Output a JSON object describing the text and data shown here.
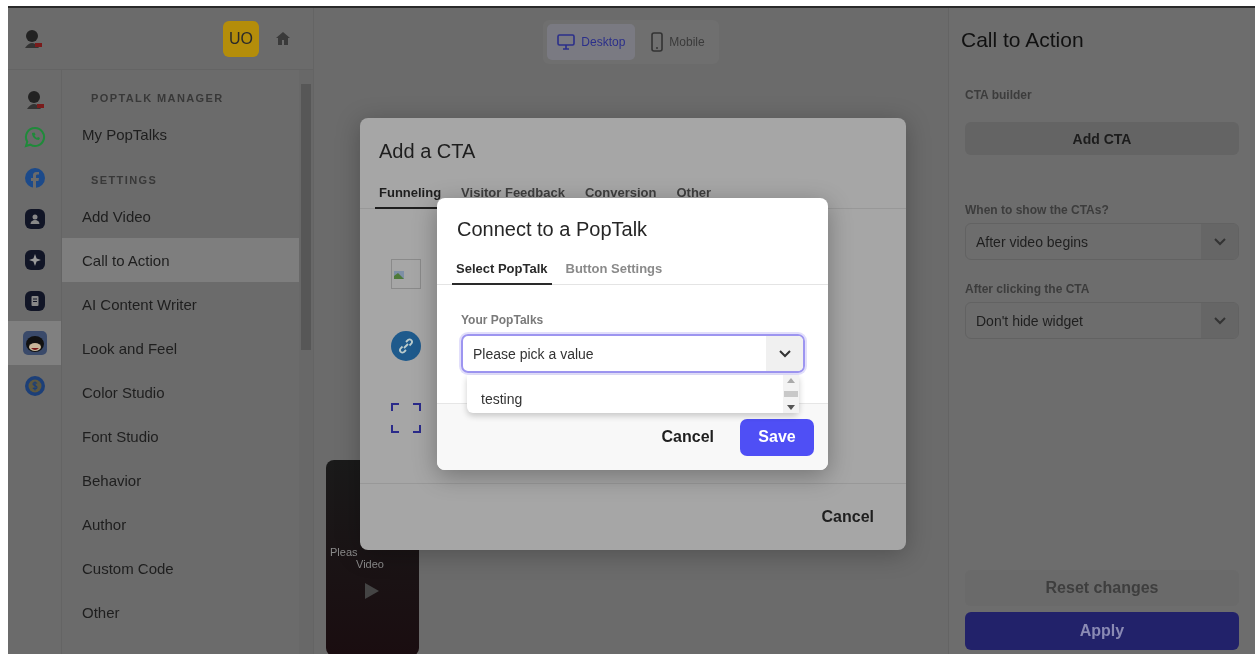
{
  "header": {
    "avatar": "UO"
  },
  "rail": [
    {
      "kind": "logo",
      "selected": false
    },
    {
      "kind": "chat",
      "selected": false
    },
    {
      "kind": "facebook",
      "selected": false
    },
    {
      "kind": "person",
      "selected": false
    },
    {
      "kind": "sparkle",
      "selected": false
    },
    {
      "kind": "form",
      "selected": false
    },
    {
      "kind": "cartoon",
      "selected": true
    },
    {
      "kind": "dollar",
      "selected": false
    }
  ],
  "menu": [
    {
      "title": "POPTALK MANAGER",
      "items": [
        {
          "label": "My PopTalks",
          "selected": false
        }
      ]
    },
    {
      "title": "SETTINGS",
      "items": [
        {
          "label": "Add Video",
          "selected": false
        },
        {
          "label": "Call to Action",
          "selected": true
        },
        {
          "label": "AI Content Writer",
          "selected": false
        },
        {
          "label": "Look and Feel",
          "selected": false
        },
        {
          "label": "Color Studio",
          "selected": false
        },
        {
          "label": "Font Studio",
          "selected": false
        },
        {
          "label": "Behavior",
          "selected": false
        },
        {
          "label": "Author",
          "selected": false
        },
        {
          "label": "Custom Code",
          "selected": false
        },
        {
          "label": "Other",
          "selected": false
        }
      ]
    }
  ],
  "device_toggle": [
    {
      "kind": "desktop",
      "label": "Desktop",
      "selected": true
    },
    {
      "kind": "mobile",
      "label": "Mobile",
      "selected": false
    }
  ],
  "preview": {
    "lines": [
      "Pleas",
      "Video"
    ]
  },
  "cta_dialog": {
    "title": "Add a CTA",
    "tabs": [
      {
        "label": "Funneling",
        "selected": true
      },
      {
        "label": "Visitor Feedback",
        "selected": false
      },
      {
        "label": "Conversion",
        "selected": false
      },
      {
        "label": "Other",
        "selected": false
      }
    ],
    "cancel": "Cancel"
  },
  "connect_dialog": {
    "title": "Connect to a PopTalk",
    "tabs": [
      {
        "label": "Select PopTalk",
        "selected": true
      },
      {
        "label": "Button Settings",
        "selected": false
      }
    ],
    "field_label": "Your PopTalks",
    "placeholder": "Please pick a value",
    "options": [
      "testing"
    ],
    "cancel": "Cancel",
    "save": "Save"
  },
  "right_panel": {
    "title": "Call to Action",
    "section": "CTA builder",
    "add_button": "Add CTA",
    "selects": [
      {
        "label": "When to show the CTAs?",
        "value": "After video begins"
      },
      {
        "label": "After clicking the CTA",
        "value": "Don't hide widget"
      }
    ],
    "reset": "Reset changes",
    "apply": "Apply"
  }
}
